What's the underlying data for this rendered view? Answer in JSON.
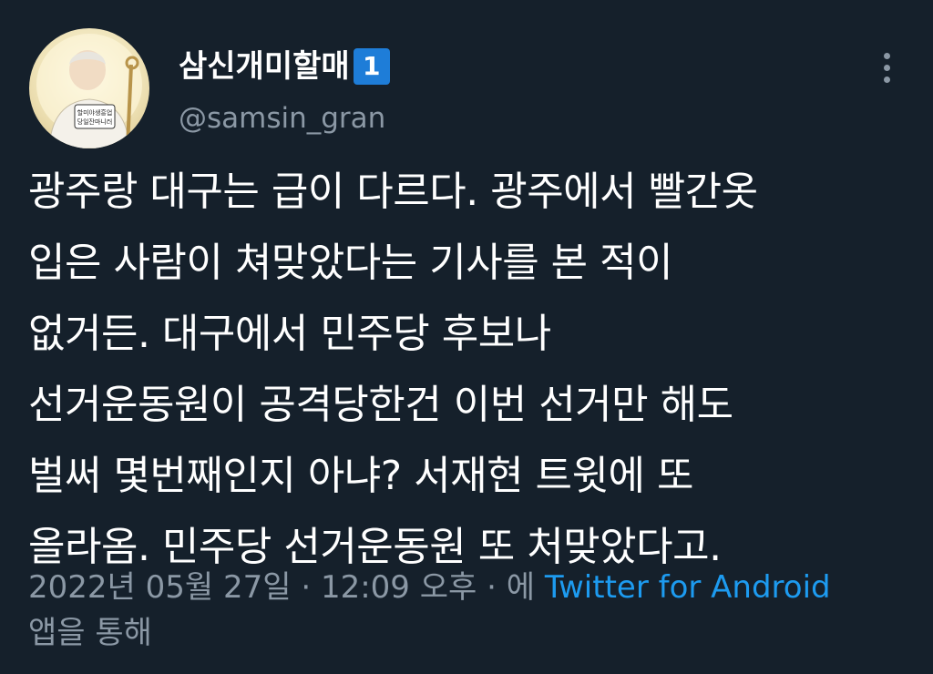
{
  "user": {
    "display_name": "삼신개미할매",
    "badge": "1",
    "handle": "@samsin_gran",
    "avatar_caption_line1": "할미야생흥업",
    "avatar_caption_line2": "당일잔마니러"
  },
  "tweet": {
    "lines": [
      "광주랑 대구는 급이 다르다. 광주에서 빨간옷",
      "입은 사람이 쳐맞았다는 기사를 본 적이",
      "없거든. 대구에서 민주당 후보나",
      "선거운동원이 공격당한건 이번 선거만 해도",
      "벌써 몇번째인지 아냐? 서재현 트윗에 또",
      "올라옴. 민주당 선거운동원 또 처맞았다고."
    ]
  },
  "meta": {
    "date": "2022년 05월 27일",
    "sep1": " · ",
    "time": "12:09 오후",
    "sep2": " · ",
    "via_prefix": "에 ",
    "source": "Twitter for Android",
    "via_suffix": "앱을 통해"
  },
  "colors": {
    "background": "#15202b",
    "text": "#ffffff",
    "secondary": "#8b98a5",
    "link": "#1d9bf0",
    "badge": "#1e7dd8"
  },
  "icons": {
    "more": "more-vertical-icon"
  }
}
